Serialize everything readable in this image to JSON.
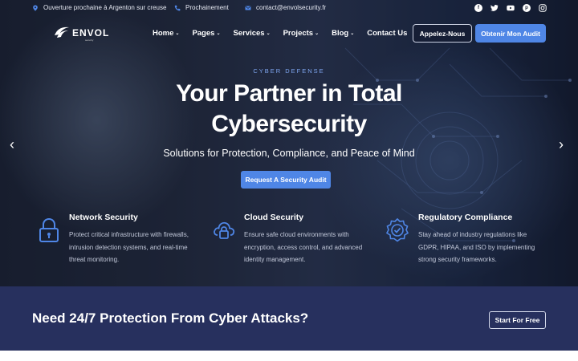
{
  "topbar": {
    "address": "Ouverture prochaine à Argenton sur creuse",
    "phone": "Prochainement",
    "email": "contact@envolsecurity.fr",
    "socials": [
      "facebook-icon",
      "twitter-icon",
      "youtube-icon",
      "pinterest-icon",
      "instagram-icon"
    ]
  },
  "nav": {
    "logo_text": "ENVOL",
    "logo_sub": "security",
    "menu": [
      {
        "label": "Home",
        "dropdown": true
      },
      {
        "label": "Pages",
        "dropdown": true
      },
      {
        "label": "Services",
        "dropdown": true
      },
      {
        "label": "Projects",
        "dropdown": true
      },
      {
        "label": "Blog",
        "dropdown": true
      },
      {
        "label": "Contact Us",
        "dropdown": false
      }
    ],
    "call_label": "Appelez-Nous",
    "audit_label": "Obtenir Mon Audit"
  },
  "hero": {
    "eyebrow": "CYBER DEFENSE",
    "title": "Your Partner in Total Cybersecurity",
    "subtitle": "Solutions for Protection, Compliance, and Peace of Mind",
    "cta": "Request A Security Audit"
  },
  "features": [
    {
      "icon": "padlock-icon",
      "title": "Network Security",
      "desc": "Protect critical infrastructure with firewalls, intrusion detection systems, and real-time threat monitoring."
    },
    {
      "icon": "cloud-lock-icon",
      "title": "Cloud Security",
      "desc": "Ensure safe cloud environments with encryption, access control, and advanced identity management."
    },
    {
      "icon": "badge-check-icon",
      "title": "Regulatory Compliance",
      "desc": "Stay ahead of industry regulations like GDPR, HIPAA, and ISO by implementing strong security frameworks."
    }
  ],
  "band": {
    "text": "Need 24/7 Protection From Cyber Attacks?",
    "button": "Start For Free"
  },
  "colors": {
    "accent": "#4f86e6",
    "band": "#27305e",
    "eyebrow": "#7fa6f0"
  }
}
